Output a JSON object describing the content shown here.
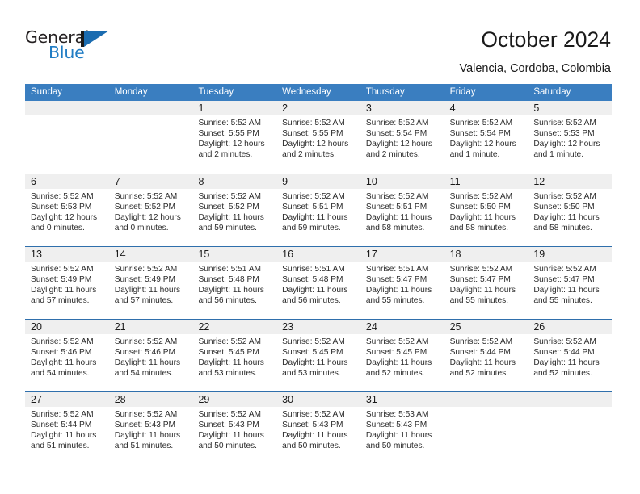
{
  "brand": {
    "name_top": "General",
    "name_bottom": "Blue",
    "logo_icon": "blue-triangle-mark",
    "accent_color": "#1b6cb0"
  },
  "header": {
    "title": "October 2024",
    "subtitle": "Valencia, Cordoba, Colombia"
  },
  "calendar": {
    "header_bg": "#3a7ec0",
    "row_divider_color": "#2f6fac",
    "day_band_bg": "#efefef",
    "weekdays": [
      "Sunday",
      "Monday",
      "Tuesday",
      "Wednesday",
      "Thursday",
      "Friday",
      "Saturday"
    ],
    "weeks": [
      [
        {
          "day": "",
          "lines": []
        },
        {
          "day": "",
          "lines": []
        },
        {
          "day": "1",
          "lines": [
            "Sunrise: 5:52 AM",
            "Sunset: 5:55 PM",
            "Daylight: 12 hours",
            "and 2 minutes."
          ]
        },
        {
          "day": "2",
          "lines": [
            "Sunrise: 5:52 AM",
            "Sunset: 5:55 PM",
            "Daylight: 12 hours",
            "and 2 minutes."
          ]
        },
        {
          "day": "3",
          "lines": [
            "Sunrise: 5:52 AM",
            "Sunset: 5:54 PM",
            "Daylight: 12 hours",
            "and 2 minutes."
          ]
        },
        {
          "day": "4",
          "lines": [
            "Sunrise: 5:52 AM",
            "Sunset: 5:54 PM",
            "Daylight: 12 hours",
            "and 1 minute."
          ]
        },
        {
          "day": "5",
          "lines": [
            "Sunrise: 5:52 AM",
            "Sunset: 5:53 PM",
            "Daylight: 12 hours",
            "and 1 minute."
          ]
        }
      ],
      [
        {
          "day": "6",
          "lines": [
            "Sunrise: 5:52 AM",
            "Sunset: 5:53 PM",
            "Daylight: 12 hours",
            "and 0 minutes."
          ]
        },
        {
          "day": "7",
          "lines": [
            "Sunrise: 5:52 AM",
            "Sunset: 5:52 PM",
            "Daylight: 12 hours",
            "and 0 minutes."
          ]
        },
        {
          "day": "8",
          "lines": [
            "Sunrise: 5:52 AM",
            "Sunset: 5:52 PM",
            "Daylight: 11 hours",
            "and 59 minutes."
          ]
        },
        {
          "day": "9",
          "lines": [
            "Sunrise: 5:52 AM",
            "Sunset: 5:51 PM",
            "Daylight: 11 hours",
            "and 59 minutes."
          ]
        },
        {
          "day": "10",
          "lines": [
            "Sunrise: 5:52 AM",
            "Sunset: 5:51 PM",
            "Daylight: 11 hours",
            "and 58 minutes."
          ]
        },
        {
          "day": "11",
          "lines": [
            "Sunrise: 5:52 AM",
            "Sunset: 5:50 PM",
            "Daylight: 11 hours",
            "and 58 minutes."
          ]
        },
        {
          "day": "12",
          "lines": [
            "Sunrise: 5:52 AM",
            "Sunset: 5:50 PM",
            "Daylight: 11 hours",
            "and 58 minutes."
          ]
        }
      ],
      [
        {
          "day": "13",
          "lines": [
            "Sunrise: 5:52 AM",
            "Sunset: 5:49 PM",
            "Daylight: 11 hours",
            "and 57 minutes."
          ]
        },
        {
          "day": "14",
          "lines": [
            "Sunrise: 5:52 AM",
            "Sunset: 5:49 PM",
            "Daylight: 11 hours",
            "and 57 minutes."
          ]
        },
        {
          "day": "15",
          "lines": [
            "Sunrise: 5:51 AM",
            "Sunset: 5:48 PM",
            "Daylight: 11 hours",
            "and 56 minutes."
          ]
        },
        {
          "day": "16",
          "lines": [
            "Sunrise: 5:51 AM",
            "Sunset: 5:48 PM",
            "Daylight: 11 hours",
            "and 56 minutes."
          ]
        },
        {
          "day": "17",
          "lines": [
            "Sunrise: 5:51 AM",
            "Sunset: 5:47 PM",
            "Daylight: 11 hours",
            "and 55 minutes."
          ]
        },
        {
          "day": "18",
          "lines": [
            "Sunrise: 5:52 AM",
            "Sunset: 5:47 PM",
            "Daylight: 11 hours",
            "and 55 minutes."
          ]
        },
        {
          "day": "19",
          "lines": [
            "Sunrise: 5:52 AM",
            "Sunset: 5:47 PM",
            "Daylight: 11 hours",
            "and 55 minutes."
          ]
        }
      ],
      [
        {
          "day": "20",
          "lines": [
            "Sunrise: 5:52 AM",
            "Sunset: 5:46 PM",
            "Daylight: 11 hours",
            "and 54 minutes."
          ]
        },
        {
          "day": "21",
          "lines": [
            "Sunrise: 5:52 AM",
            "Sunset: 5:46 PM",
            "Daylight: 11 hours",
            "and 54 minutes."
          ]
        },
        {
          "day": "22",
          "lines": [
            "Sunrise: 5:52 AM",
            "Sunset: 5:45 PM",
            "Daylight: 11 hours",
            "and 53 minutes."
          ]
        },
        {
          "day": "23",
          "lines": [
            "Sunrise: 5:52 AM",
            "Sunset: 5:45 PM",
            "Daylight: 11 hours",
            "and 53 minutes."
          ]
        },
        {
          "day": "24",
          "lines": [
            "Sunrise: 5:52 AM",
            "Sunset: 5:45 PM",
            "Daylight: 11 hours",
            "and 52 minutes."
          ]
        },
        {
          "day": "25",
          "lines": [
            "Sunrise: 5:52 AM",
            "Sunset: 5:44 PM",
            "Daylight: 11 hours",
            "and 52 minutes."
          ]
        },
        {
          "day": "26",
          "lines": [
            "Sunrise: 5:52 AM",
            "Sunset: 5:44 PM",
            "Daylight: 11 hours",
            "and 52 minutes."
          ]
        }
      ],
      [
        {
          "day": "27",
          "lines": [
            "Sunrise: 5:52 AM",
            "Sunset: 5:44 PM",
            "Daylight: 11 hours",
            "and 51 minutes."
          ]
        },
        {
          "day": "28",
          "lines": [
            "Sunrise: 5:52 AM",
            "Sunset: 5:43 PM",
            "Daylight: 11 hours",
            "and 51 minutes."
          ]
        },
        {
          "day": "29",
          "lines": [
            "Sunrise: 5:52 AM",
            "Sunset: 5:43 PM",
            "Daylight: 11 hours",
            "and 50 minutes."
          ]
        },
        {
          "day": "30",
          "lines": [
            "Sunrise: 5:52 AM",
            "Sunset: 5:43 PM",
            "Daylight: 11 hours",
            "and 50 minutes."
          ]
        },
        {
          "day": "31",
          "lines": [
            "Sunrise: 5:53 AM",
            "Sunset: 5:43 PM",
            "Daylight: 11 hours",
            "and 50 minutes."
          ]
        },
        {
          "day": "",
          "lines": []
        },
        {
          "day": "",
          "lines": []
        }
      ]
    ]
  }
}
